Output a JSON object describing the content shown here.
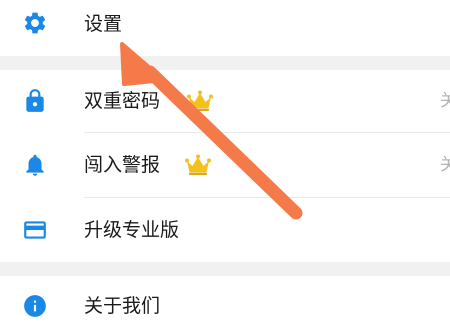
{
  "colors": {
    "icon_blue": "#1a88e6",
    "section_gap": "#f1f1f1",
    "divider": "#e9e9e9",
    "crown_gold": "#f2c21b",
    "arrow_orange": "#f47a4a"
  },
  "menu": {
    "settings": {
      "label": "设置",
      "icon": "gear-icon"
    },
    "two_factor": {
      "label": "双重密码",
      "icon": "lock-icon",
      "badge": "crown-icon",
      "trailing": "关"
    },
    "intrusion_alert": {
      "label": "闯入警报",
      "icon": "bell-icon",
      "badge": "crown-icon",
      "trailing": "关"
    },
    "upgrade": {
      "label": "升级专业版",
      "icon": "card-icon"
    },
    "about": {
      "label": "关于我们",
      "icon": "info-icon"
    }
  },
  "annotation": {
    "icon": "arrow-pointer",
    "target": "settings"
  }
}
